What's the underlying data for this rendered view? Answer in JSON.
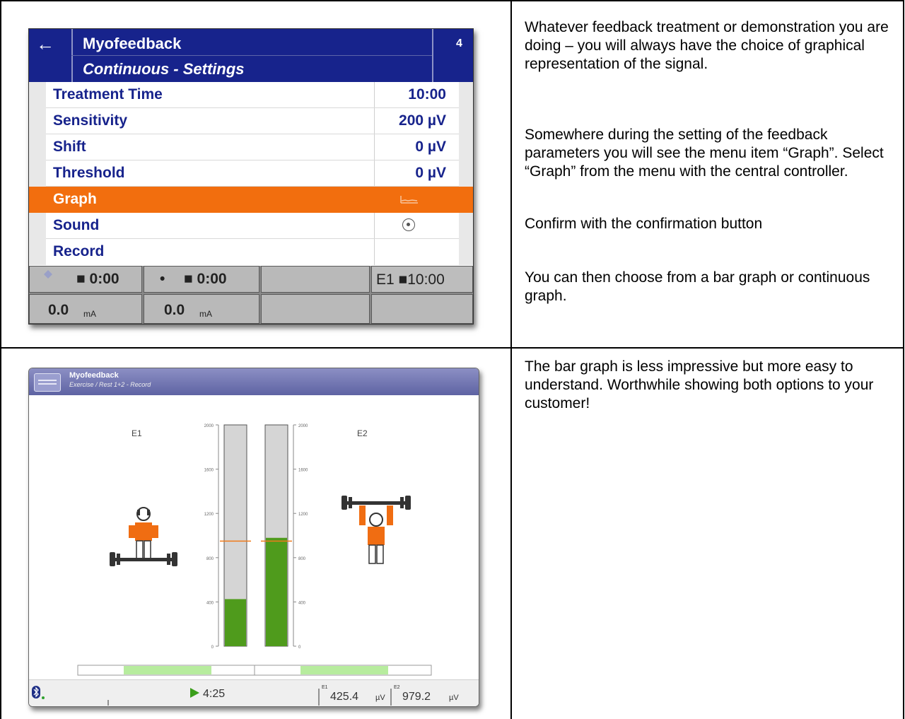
{
  "doc": {
    "row1_text": [
      "Whatever feedback treatment or demonstration you are doing – you will always have the choice of graphical representation of the signal.",
      "Somewhere during the setting of the feedback parameters you will see the menu item “Graph”. Select “Graph” from the menu with the central controller.",
      "Confirm with the confirmation button",
      "You can then choose from a bar graph or continuous graph."
    ],
    "row2_text": [
      "The bar graph is less impressive but more easy to understand. Worthwhile showing both options to your customer!"
    ]
  },
  "screen1": {
    "title": "Myofeedback",
    "subtitle": "Continuous - Settings",
    "page_number": "4",
    "back_icon": "arrow-left-icon",
    "rows": [
      {
        "label": "Treatment Time",
        "value": "10:00"
      },
      {
        "label": "Sensitivity",
        "value": "200 µV"
      },
      {
        "label": "Shift",
        "value": "0 µV"
      },
      {
        "label": "Threshold",
        "value": "0 µV"
      },
      {
        "label": "Graph",
        "value": "",
        "icon": "graph-icon",
        "selected": true
      },
      {
        "label": "Sound",
        "value": "",
        "icon": "radio-icon"
      },
      {
        "label": "Record",
        "value": ""
      }
    ],
    "footer": {
      "ch1_time": "■ 0:00",
      "ch2_dot": "•",
      "ch2_time": "■ 0:00",
      "ch1_current": "0.0",
      "ch2_current": "0.0",
      "unit": "mA",
      "e1_timer": "E1 ■10:00"
    },
    "accent_color": "#f26e0e",
    "header_color": "#17238c"
  },
  "screen2": {
    "title": "Myofeedback",
    "subtitle": "Exercise / Rest 1+2 - Record",
    "label_e1": "E1",
    "label_e2": "E2",
    "play_time": "4:25",
    "e1_value": "425.4",
    "e2_value": "979.2",
    "value_unit": "µV",
    "e1_small": "E1",
    "e2_small": "E2",
    "bar_color": "#4f9b1c",
    "threshold_color": "#f07a1a"
  },
  "chart_data": {
    "type": "bar",
    "categories": [
      "E1",
      "E2"
    ],
    "values": [
      425.4,
      979.2
    ],
    "ylim": [
      0,
      2000
    ],
    "yticks": [
      "0",
      "400",
      "800",
      "1200",
      "1600",
      "2000"
    ],
    "thresholds": [
      950,
      950
    ]
  }
}
